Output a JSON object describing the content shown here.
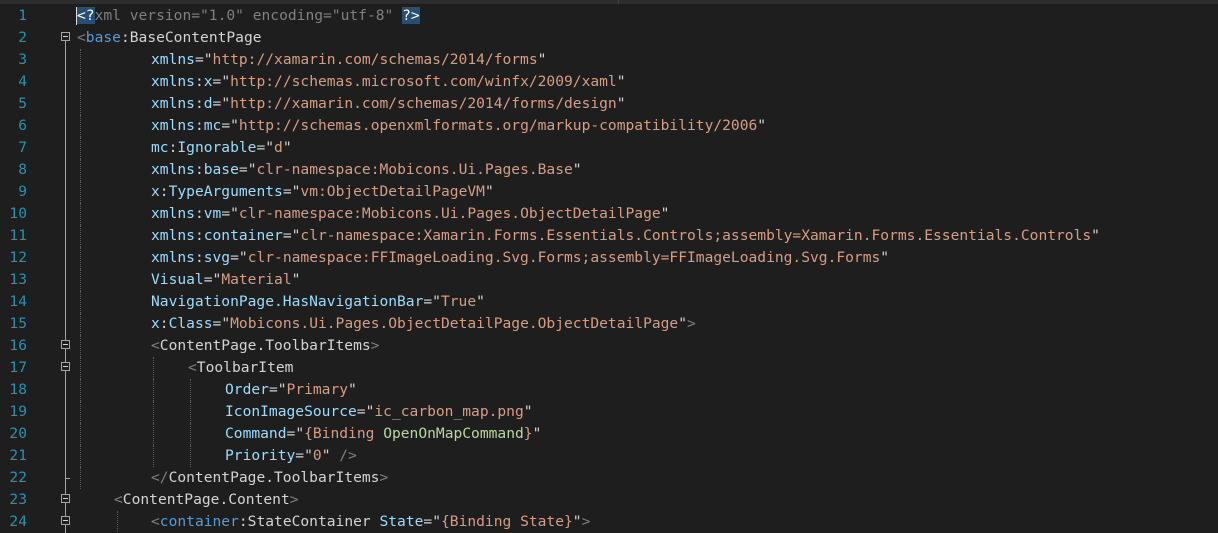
{
  "editor": {
    "language": "XAML",
    "lines": [
      {
        "n": "1",
        "fold": "none",
        "indent": 0,
        "tokens": [
          [
            "sel",
            "<?"
          ],
          [
            "pi",
            "xml version=\"1.0\" encoding=\"utf-8\" "
          ],
          [
            "sel",
            "?>"
          ]
        ]
      },
      {
        "n": "2",
        "fold": "open",
        "indent": 0,
        "tokens": [
          [
            "delim",
            "<"
          ],
          [
            "pre",
            "base"
          ],
          [
            "colon",
            ":"
          ],
          [
            "el",
            "BaseContentPage"
          ]
        ]
      },
      {
        "n": "3",
        "fold": "none",
        "indent": 10,
        "tokens": [
          [
            "attr",
            "xmlns"
          ],
          [
            "eq",
            "="
          ],
          [
            "q",
            "\""
          ],
          [
            "str",
            "http://xamarin.com/schemas/2014/forms"
          ],
          [
            "q",
            "\""
          ]
        ]
      },
      {
        "n": "4",
        "fold": "none",
        "indent": 10,
        "tokens": [
          [
            "attr",
            "xmlns"
          ],
          [
            "colon",
            ":"
          ],
          [
            "attr",
            "x"
          ],
          [
            "eq",
            "="
          ],
          [
            "q",
            "\""
          ],
          [
            "str",
            "http://schemas.microsoft.com/winfx/2009/xaml"
          ],
          [
            "q",
            "\""
          ]
        ]
      },
      {
        "n": "5",
        "fold": "none",
        "indent": 10,
        "tokens": [
          [
            "attr",
            "xmlns"
          ],
          [
            "colon",
            ":"
          ],
          [
            "attr",
            "d"
          ],
          [
            "eq",
            "="
          ],
          [
            "q",
            "\""
          ],
          [
            "str",
            "http://xamarin.com/schemas/2014/forms/design"
          ],
          [
            "q",
            "\""
          ]
        ]
      },
      {
        "n": "6",
        "fold": "none",
        "indent": 10,
        "tokens": [
          [
            "attr",
            "xmlns"
          ],
          [
            "colon",
            ":"
          ],
          [
            "attr",
            "mc"
          ],
          [
            "eq",
            "="
          ],
          [
            "q",
            "\""
          ],
          [
            "str",
            "http://schemas.openxmlformats.org/markup-compatibility/2006"
          ],
          [
            "q",
            "\""
          ]
        ]
      },
      {
        "n": "7",
        "fold": "none",
        "indent": 10,
        "tokens": [
          [
            "attr",
            "mc"
          ],
          [
            "colon",
            ":"
          ],
          [
            "attr",
            "Ignorable"
          ],
          [
            "eq",
            "="
          ],
          [
            "q",
            "\""
          ],
          [
            "str",
            "d"
          ],
          [
            "q",
            "\""
          ]
        ]
      },
      {
        "n": "8",
        "fold": "none",
        "indent": 10,
        "tokens": [
          [
            "attr",
            "xmlns"
          ],
          [
            "colon",
            ":"
          ],
          [
            "attr",
            "base"
          ],
          [
            "eq",
            "="
          ],
          [
            "q",
            "\""
          ],
          [
            "str",
            "clr-namespace:Mobicons.Ui.Pages.Base"
          ],
          [
            "q",
            "\""
          ]
        ]
      },
      {
        "n": "9",
        "fold": "none",
        "indent": 10,
        "tokens": [
          [
            "attr",
            "x"
          ],
          [
            "colon",
            ":"
          ],
          [
            "attr",
            "TypeArguments"
          ],
          [
            "eq",
            "="
          ],
          [
            "q",
            "\""
          ],
          [
            "str",
            "vm:ObjectDetailPageVM"
          ],
          [
            "q",
            "\""
          ]
        ]
      },
      {
        "n": "10",
        "fold": "none",
        "indent": 10,
        "tokens": [
          [
            "attr",
            "xmlns"
          ],
          [
            "colon",
            ":"
          ],
          [
            "attr",
            "vm"
          ],
          [
            "eq",
            "="
          ],
          [
            "q",
            "\""
          ],
          [
            "str",
            "clr-namespace:Mobicons.Ui.Pages.ObjectDetailPage"
          ],
          [
            "q",
            "\""
          ]
        ]
      },
      {
        "n": "11",
        "fold": "none",
        "indent": 10,
        "tokens": [
          [
            "attr",
            "xmlns"
          ],
          [
            "colon",
            ":"
          ],
          [
            "attr",
            "container"
          ],
          [
            "eq",
            "="
          ],
          [
            "q",
            "\""
          ],
          [
            "str",
            "clr-namespace:Xamarin.Forms.Essentials.Controls;assembly=Xamarin.Forms.Essentials.Controls"
          ],
          [
            "q",
            "\""
          ]
        ]
      },
      {
        "n": "12",
        "fold": "none",
        "indent": 10,
        "tokens": [
          [
            "attr",
            "xmlns"
          ],
          [
            "colon",
            ":"
          ],
          [
            "attr",
            "svg"
          ],
          [
            "eq",
            "="
          ],
          [
            "q",
            "\""
          ],
          [
            "str",
            "clr-namespace:FFImageLoading.Svg.Forms;assembly=FFImageLoading.Svg.Forms"
          ],
          [
            "q",
            "\""
          ]
        ]
      },
      {
        "n": "13",
        "fold": "none",
        "indent": 10,
        "tokens": [
          [
            "attr",
            "Visual"
          ],
          [
            "eq",
            "="
          ],
          [
            "q",
            "\""
          ],
          [
            "str",
            "Material"
          ],
          [
            "q",
            "\""
          ]
        ]
      },
      {
        "n": "14",
        "fold": "none",
        "indent": 10,
        "tokens": [
          [
            "attr",
            "NavigationPage.HasNavigationBar"
          ],
          [
            "eq",
            "="
          ],
          [
            "q",
            "\""
          ],
          [
            "str",
            "True"
          ],
          [
            "q",
            "\""
          ]
        ]
      },
      {
        "n": "15",
        "fold": "none",
        "indent": 10,
        "tokens": [
          [
            "attr",
            "x"
          ],
          [
            "colon",
            ":"
          ],
          [
            "attr",
            "Class"
          ],
          [
            "eq",
            "="
          ],
          [
            "q",
            "\""
          ],
          [
            "str",
            "Mobicons.Ui.Pages.ObjectDetailPage.ObjectDetailPage"
          ],
          [
            "q",
            "\""
          ],
          [
            "delim",
            ">"
          ]
        ]
      },
      {
        "n": "16",
        "fold": "open",
        "indent": 10,
        "tokens": [
          [
            "delim",
            "<"
          ],
          [
            "el",
            "ContentPage.ToolbarItems"
          ],
          [
            "delim",
            ">"
          ]
        ]
      },
      {
        "n": "17",
        "fold": "open",
        "indent": 15,
        "tokens": [
          [
            "delim",
            "<"
          ],
          [
            "el",
            "ToolbarItem"
          ]
        ]
      },
      {
        "n": "18",
        "fold": "none",
        "indent": 20,
        "tokens": [
          [
            "attr",
            "Order"
          ],
          [
            "eq",
            "="
          ],
          [
            "q",
            "\""
          ],
          [
            "str",
            "Primary"
          ],
          [
            "q",
            "\""
          ]
        ]
      },
      {
        "n": "19",
        "fold": "none",
        "indent": 20,
        "tokens": [
          [
            "attr",
            "IconImageSource"
          ],
          [
            "eq",
            "="
          ],
          [
            "q",
            "\""
          ],
          [
            "str",
            "ic_carbon_map.png"
          ],
          [
            "q",
            "\""
          ]
        ]
      },
      {
        "n": "20",
        "fold": "none",
        "indent": 20,
        "tokens": [
          [
            "attr",
            "Command"
          ],
          [
            "eq",
            "="
          ],
          [
            "q",
            "\""
          ],
          [
            "str",
            "{Binding "
          ],
          [
            "bind",
            "OpenOnMapCommand"
          ],
          [
            "str",
            "}"
          ],
          [
            "q",
            "\""
          ]
        ]
      },
      {
        "n": "21",
        "fold": "none",
        "indent": 20,
        "tokens": [
          [
            "attr",
            "Priority"
          ],
          [
            "eq",
            "="
          ],
          [
            "q",
            "\""
          ],
          [
            "str",
            "0"
          ],
          [
            "q",
            "\""
          ],
          [
            "delim",
            " />"
          ]
        ]
      },
      {
        "n": "22",
        "fold": "end",
        "indent": 10,
        "tokens": [
          [
            "delim",
            "</"
          ],
          [
            "el",
            "ContentPage.ToolbarItems"
          ],
          [
            "delim",
            ">"
          ]
        ]
      },
      {
        "n": "23",
        "fold": "open",
        "indent": 5,
        "tokens": [
          [
            "delim",
            "<"
          ],
          [
            "el",
            "ContentPage.Content"
          ],
          [
            "delim",
            ">"
          ]
        ]
      },
      {
        "n": "24",
        "fold": "open",
        "indent": 10,
        "tokens": [
          [
            "delim",
            "<"
          ],
          [
            "pre",
            "container"
          ],
          [
            "colon",
            ":"
          ],
          [
            "el",
            "StateContainer"
          ],
          [
            "attr",
            " State"
          ],
          [
            "eq",
            "="
          ],
          [
            "q",
            "\""
          ],
          [
            "str",
            "{Binding State}"
          ],
          [
            "q",
            "\""
          ],
          [
            "delim",
            ">"
          ]
        ]
      }
    ]
  }
}
